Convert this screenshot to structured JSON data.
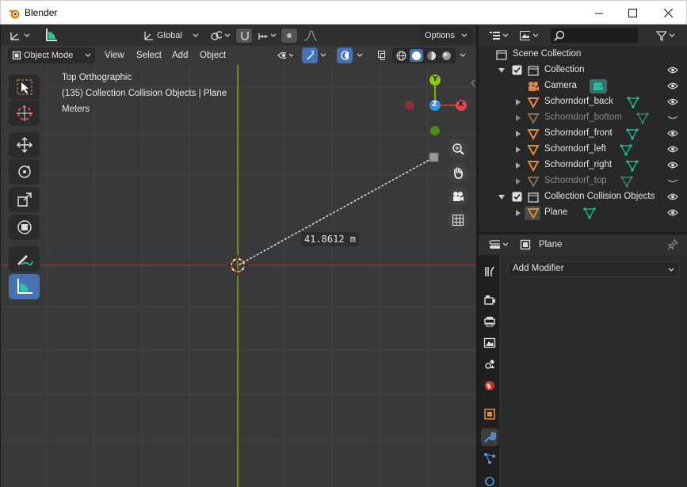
{
  "window": {
    "title": "Blender"
  },
  "viewport": {
    "header": {
      "orientation": "Global",
      "options_label": "Options"
    },
    "menu": {
      "mode": "Object Mode",
      "view": "View",
      "select": "Select",
      "add": "Add",
      "object": "Object"
    },
    "overlay": {
      "view_name": "Top Orthographic",
      "collection_info": "(135) Collection Collision Objects | Plane",
      "units": "Meters"
    },
    "measure": {
      "value": "41.8612 m"
    },
    "gizmo": {
      "y": "Y",
      "z": "Z",
      "x": "X"
    }
  },
  "outliner": {
    "scene_collection": "Scene Collection",
    "rows": [
      {
        "label": "Collection"
      },
      {
        "label": "Camera"
      },
      {
        "label": "Schorndorf_back"
      },
      {
        "label": "Schorndorf_bottom"
      },
      {
        "label": "Schorndorf_front"
      },
      {
        "label": "Schorndorf_left"
      },
      {
        "label": "Schorndorf_right"
      },
      {
        "label": "Schorndorf_top"
      },
      {
        "label": "Collection Collision Objects"
      },
      {
        "label": "Plane"
      }
    ]
  },
  "properties": {
    "object_name": "Plane",
    "add_modifier": "Add Modifier"
  },
  "colors": {
    "accent": "#4772b3",
    "axis_x": "#c0392b",
    "axis_y": "#7fb300",
    "mesh_icon": "#1fc6a0",
    "object_icon": "#e08a3e"
  }
}
